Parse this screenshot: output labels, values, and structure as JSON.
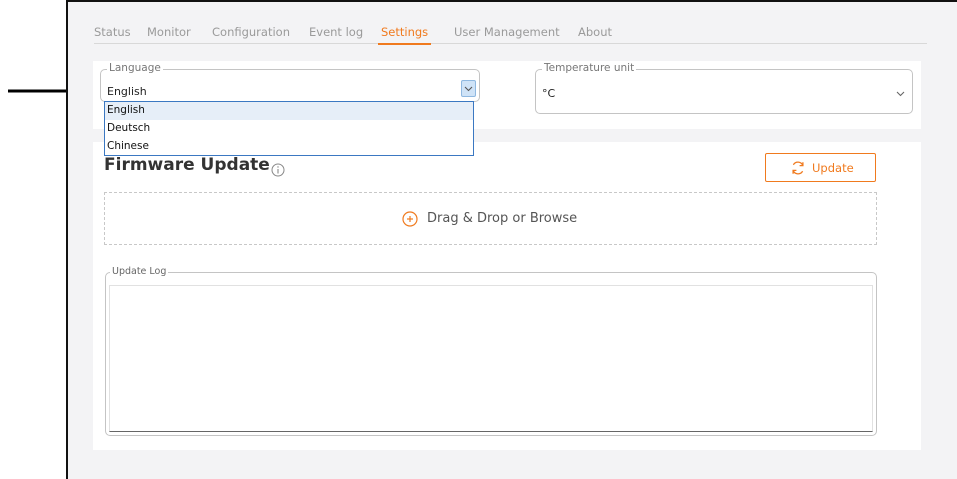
{
  "tabs": [
    {
      "label": "Status"
    },
    {
      "label": "Monitor"
    },
    {
      "label": "Configuration"
    },
    {
      "label": "Event log"
    },
    {
      "label": "Settings",
      "active": true
    },
    {
      "label": "User Management"
    },
    {
      "label": "About"
    }
  ],
  "settings": {
    "language": {
      "legend": "Language",
      "value": "English",
      "options": [
        "English",
        "Deutsch",
        "Chinese"
      ]
    },
    "temperature": {
      "legend": "Temperature unit",
      "value": "°C"
    }
  },
  "firmware": {
    "title": "Firmware Update",
    "update_label": "Update",
    "dropzone_label": "Drag & Drop or Browse",
    "log_legend": "Update Log"
  },
  "colors": {
    "accent": "#f07a1e",
    "focus_border": "#3b78c2"
  },
  "icons": {
    "info": "info-icon",
    "update": "refresh-icon",
    "dropzone": "plus-circle-icon",
    "select": "chevron-down-icon",
    "annotation": "arrow-right-icon"
  }
}
